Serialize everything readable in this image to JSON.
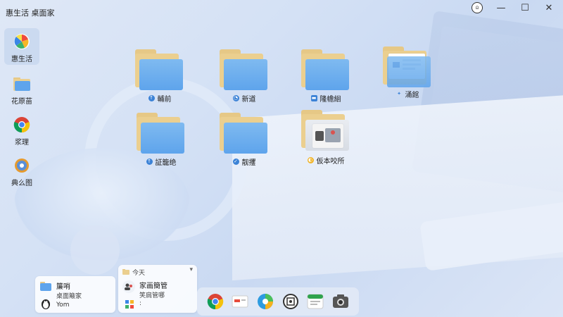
{
  "window": {
    "title": "惠生活 桌面家"
  },
  "sidebar": {
    "items": [
      {
        "label": "惠生活",
        "icon": "windmill-icon",
        "active": true
      },
      {
        "label": "花原苗",
        "icon": "folder-icon",
        "active": false
      },
      {
        "label": "浆理",
        "icon": "chrome-icon",
        "active": false
      },
      {
        "label": "典么图",
        "icon": "gear-icon",
        "active": false
      }
    ]
  },
  "desktop": {
    "folders": [
      {
        "label": "輔前",
        "badge": "a"
      },
      {
        "label": "新道",
        "badge": "b"
      },
      {
        "label": "隆幨絗",
        "badge": "c"
      },
      {
        "label": "涌館",
        "badge": "d"
      },
      {
        "label": "証籠绝",
        "badge": "e"
      },
      {
        "label": "靓攫",
        "badge": "f"
      },
      {
        "label": "仮本咬所",
        "badge": "g"
      }
    ]
  },
  "notifications": {
    "card1": {
      "title": "簾哨",
      "subtitle": "桌面簸家",
      "user": "Yom"
    },
    "card2": {
      "header": "今天",
      "title": "家画簡管",
      "subtitle": "笑扃管哪",
      "colon": ":"
    }
  },
  "taskbar": {
    "icons": [
      "chrome-icon",
      "mail-icon",
      "browser-icon",
      "settings-icon",
      "app-store-icon",
      "camera-icon"
    ]
  },
  "colors": {
    "folder_blue": "#5ea4ec",
    "folder_tab": "#e6c886",
    "wallpaper": "#d4e1f5"
  }
}
